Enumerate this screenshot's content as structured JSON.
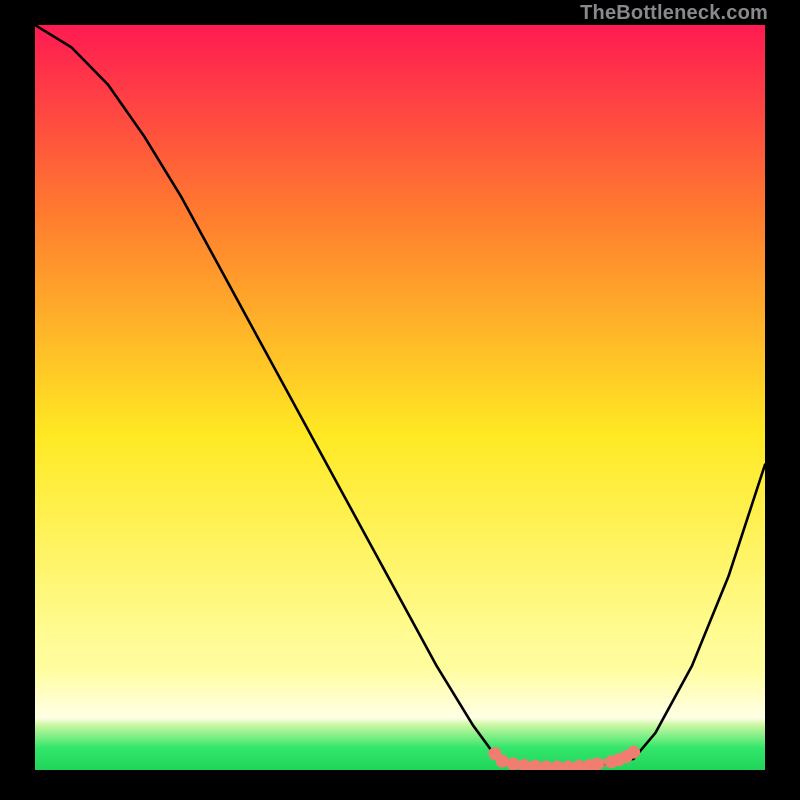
{
  "attribution": "TheBottleneck.com",
  "colors": {
    "background": "#000000",
    "gradient_top": "#ff1a52",
    "gradient_mid_upper": "#ff7a2f",
    "gradient_mid_lower": "#ffe923",
    "gradient_light": "#fffd9b",
    "gradient_bottom": "#34e66b",
    "curve": "#000000",
    "marker_fill": "#ef7e71",
    "marker_stroke": "#ef7e71"
  },
  "chart_data": {
    "type": "line",
    "title": "",
    "xlabel": "",
    "ylabel": "",
    "xlim": [
      0,
      100
    ],
    "ylim": [
      0,
      100
    ],
    "series": [
      {
        "name": "bottleneck-curve",
        "x": [
          0,
          5,
          10,
          15,
          20,
          25,
          30,
          35,
          40,
          45,
          50,
          55,
          60,
          63,
          67,
          72,
          77,
          82,
          85,
          90,
          95,
          100
        ],
        "y": [
          100,
          97,
          92,
          85,
          77,
          68,
          59,
          50,
          41,
          32,
          23,
          14,
          6,
          2,
          0.5,
          0.3,
          0.5,
          1.5,
          5,
          14,
          26,
          41
        ]
      }
    ],
    "scatter": {
      "name": "optimal-zone-markers",
      "x": [
        63,
        64,
        65.5,
        67,
        68.5,
        70,
        71.5,
        73,
        74.5,
        76,
        77,
        79,
        80,
        81,
        82
      ],
      "y": [
        2.2,
        1.2,
        0.8,
        0.6,
        0.5,
        0.4,
        0.4,
        0.4,
        0.5,
        0.6,
        0.8,
        1.1,
        1.4,
        1.8,
        2.4
      ]
    }
  }
}
